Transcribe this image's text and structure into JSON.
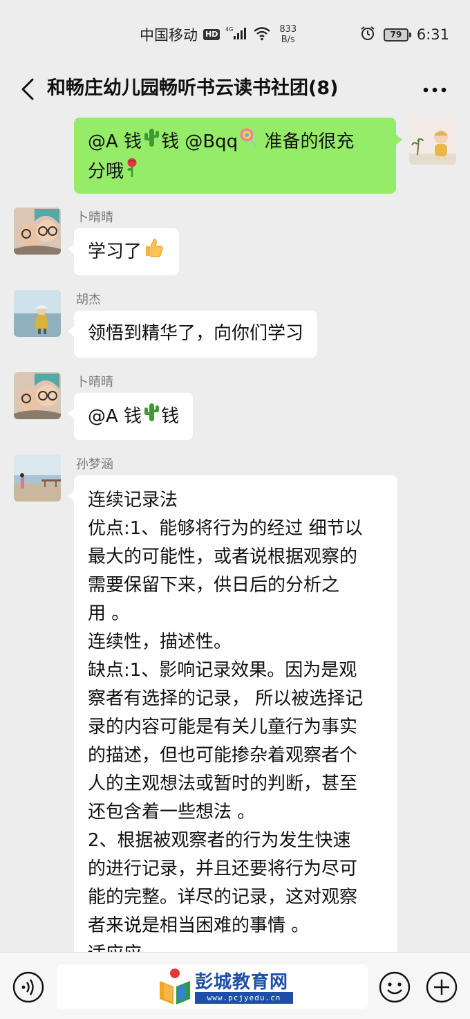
{
  "status_bar": {
    "carrier": "中国移动",
    "hd": "HD",
    "network": "4G",
    "speed_value": "833",
    "speed_unit": "B/s",
    "battery": "79",
    "time": "6:31"
  },
  "header": {
    "title": "和畅庄幼儿园畅听书云读书社团(8)",
    "back_icon": "chevron-left-icon",
    "more_icon": "more-dots-icon"
  },
  "messages": [
    {
      "direction": "out",
      "line1_a": "@A 钱",
      "line1_b": "钱  @Bqq",
      "line1_c": "  准备的很充",
      "line2": "分哦"
    },
    {
      "direction": "in",
      "sender": "卜晴晴",
      "text": "学习了"
    },
    {
      "direction": "in",
      "sender": "胡杰",
      "text": "领悟到精华了，向你们学习"
    },
    {
      "direction": "in",
      "sender": "卜晴晴",
      "text_a": "@A 钱",
      "text_b": "钱"
    },
    {
      "direction": "in",
      "sender": "孙梦涵",
      "text": "连续记录法\n优点:1、能够将行为的经过 细节以\n最大的可能性，或者说根据观察的\n需要保留下来，供日后的分析之\n用 。\n连续性，描述性。\n缺点:1、影响记录效果。因为是观\n察者有选择的记录， 所以被选择记\n录的内容可能是有关儿童行为事实\n的描述，但也可能掺杂着观察者个\n人的主观想法或暂时的判断，甚至\n还包含着一些想法 。\n2、根据被观察者的行为发生快速\n的进行记录，并且还要将行为尽可\n能的完整。详尽的记录，这对观察\n者来说是相当困难的事情 。\n适应应"
    }
  ],
  "input_bar": {
    "voice_icon": "voice-icon",
    "emoji_icon": "emoji-icon",
    "plus_icon": "plus-icon",
    "watermark_title": "彭城教育网",
    "watermark_url": "www.pcjyedu.cn"
  },
  "colors": {
    "background": "#ededed",
    "outgoing_bubble": "#95ec69",
    "incoming_bubble": "#ffffff",
    "watermark_blue": "#1e4fa8"
  }
}
